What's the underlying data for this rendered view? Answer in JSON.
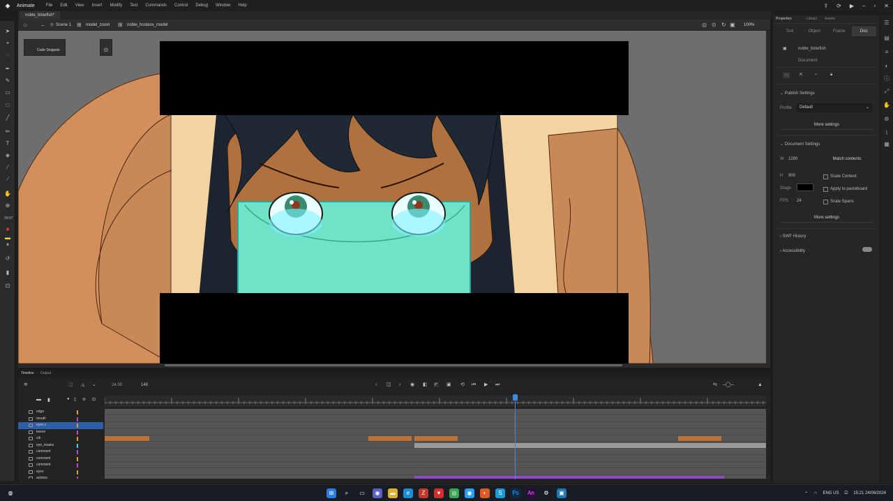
{
  "app": {
    "name": "Animate",
    "menus": [
      "File",
      "Edit",
      "View",
      "Insert",
      "Modify",
      "Text",
      "Commands",
      "Control",
      "Debug",
      "Window",
      "Help"
    ]
  },
  "document": {
    "tab_label": "noble_blowfish*",
    "breadcrumb": [
      "Scene 1",
      "model_zoom",
      "noble_hostess_model"
    ],
    "zoom": "100%"
  },
  "stage": {
    "code_snippets_label": "Code Snippets"
  },
  "properties": {
    "panel_tabs": [
      "Properties",
      "Library",
      "Assets"
    ],
    "sub_tabs": [
      "Tool",
      "Object",
      "Frame",
      "Doc"
    ],
    "active_sub_tab": "Doc",
    "doc_name": "noble_blowfish",
    "doc_type": "Document",
    "publish_settings_header": "Publish Settings",
    "profile_label": "Profile",
    "profile_value": "Default",
    "more_settings_1": "More settings",
    "doc_settings_header": "Document Settings",
    "width_label": "W",
    "width_value": "1280",
    "height_label": "H",
    "height_value": "900",
    "match_contents": "Match contents",
    "scale_content": "Scale Content",
    "stage_label": "Stage",
    "apply_pasteboard": "Apply to pasteboard",
    "fps_label": "FPS",
    "fps_value": "24",
    "scale_spans": "Scale Spans",
    "more_settings_2": "More settings",
    "swf_history": "SWF History",
    "accessibility": "Accessibility",
    "stage_color": "#000000"
  },
  "timeline": {
    "tabs": [
      "Timeline",
      "Output"
    ],
    "fps_display": "24.00",
    "frame_display": "148",
    "layers": [
      {
        "name": "edge",
        "color": "#e0a020"
      },
      {
        "name": "mouth",
        "color": "#c040e0"
      },
      {
        "name": "eyes c",
        "color": "#e0a020",
        "selected": true
      },
      {
        "name": "tween",
        "color": "#c040e0"
      },
      {
        "name": "cik",
        "color": "#e0a020"
      },
      {
        "name": "eye_masks",
        "color": "#40d0e0"
      },
      {
        "name": "comment",
        "color": "#c040e0"
      },
      {
        "name": "comment",
        "color": "#e0a020"
      },
      {
        "name": "comment",
        "color": "#c040e0"
      },
      {
        "name": "eyes",
        "color": "#e0a020"
      },
      {
        "name": "actions",
        "color": "#c040e0"
      }
    ]
  },
  "taskbar": {
    "lang": "ENG",
    "region": "US",
    "time": "15:21",
    "date": "24/06/2024"
  }
}
